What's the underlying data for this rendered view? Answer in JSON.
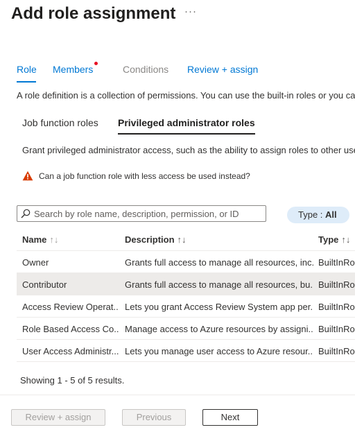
{
  "header": {
    "title": "Add role assignment",
    "more": "···"
  },
  "tabs": [
    {
      "label": "Role"
    },
    {
      "label": "Members"
    },
    {
      "label": "Conditions"
    },
    {
      "label": "Review + assign"
    }
  ],
  "description": "A role definition is a collection of permissions. You can use the built-in roles or you can create your own custom roles.",
  "subtabs": [
    {
      "label": "Job function roles"
    },
    {
      "label": "Privileged administrator roles"
    }
  ],
  "grant_text": "Grant privileged administrator access, such as the ability to assign roles to other users.",
  "warning": {
    "text": "Can a job function role with less access be used instead?",
    "icon": "warning-icon",
    "color": "#d83b01"
  },
  "search": {
    "placeholder": "Search by role name, description, permission, or ID",
    "value": ""
  },
  "type_filter": {
    "label": "Type : ",
    "value": "All"
  },
  "table": {
    "headers": {
      "name": "Name",
      "description": "Description",
      "type": "Type"
    },
    "rows": [
      {
        "name": "Owner",
        "description": "Grants full access to manage all resources, inc...",
        "type": "BuiltInRole"
      },
      {
        "name": "Contributor",
        "description": "Grants full access to manage all resources, bu...",
        "type": "BuiltInRole"
      },
      {
        "name": "Access Review Operat...",
        "description": "Lets you grant Access Review System app per...",
        "type": "BuiltInRole"
      },
      {
        "name": "Role Based Access Co...",
        "description": "Manage access to Azure resources by assigni...",
        "type": "BuiltInRole"
      },
      {
        "name": "User Access Administr...",
        "description": "Lets you manage user access to Azure resour...",
        "type": "BuiltInRole"
      }
    ]
  },
  "showing": "Showing 1 - 5 of 5 results.",
  "footer": {
    "review_label": "Review + assign",
    "previous_label": "Previous",
    "next_label": "Next"
  },
  "colors": {
    "accent": "#0078d4",
    "notification_dot": "#e81123",
    "pill_bg": "#deecf9"
  }
}
